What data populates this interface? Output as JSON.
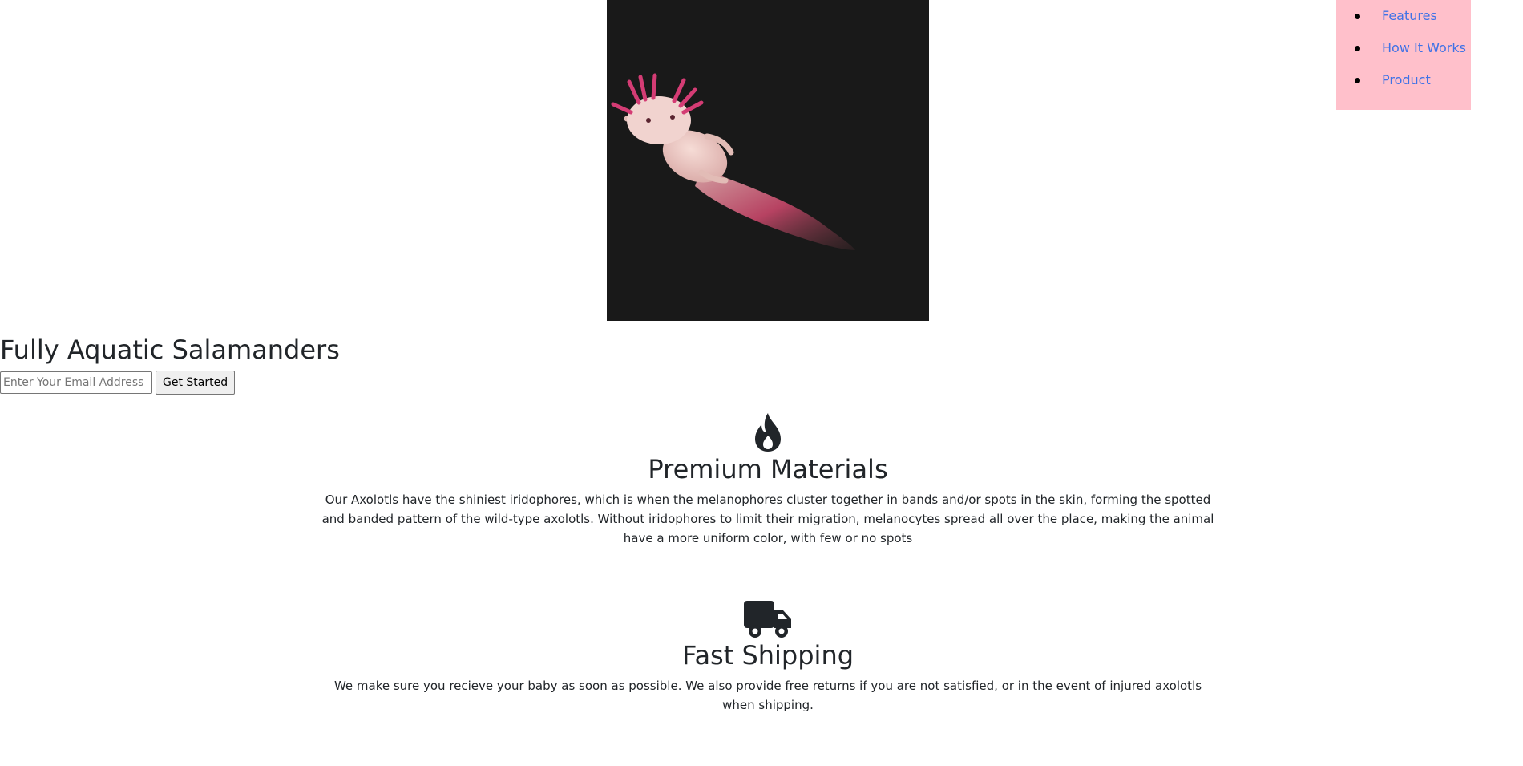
{
  "nav": {
    "items": [
      {
        "label": "Features"
      },
      {
        "label": "How It Works"
      },
      {
        "label": "Product"
      }
    ]
  },
  "hero": {
    "image_alt": "Pink axolotl",
    "title": "Fully Aquatic Salamanders",
    "email_placeholder": "Enter Your Email Address",
    "submit_label": "Get Started"
  },
  "features": [
    {
      "icon": "fire-icon",
      "title": "Premium Materials",
      "text": "Our Axolotls have the shiniest iridophores, which is when the melanophores cluster together in bands and/or spots in the skin, forming the spotted and banded pattern of the wild-type axolotls. Without iridophores to limit their migration, melanocytes spread all over the place, making the animal have a more uniform color, with few or no spots"
    },
    {
      "icon": "truck-icon",
      "title": "Fast Shipping",
      "text": "We make sure you recieve your baby as soon as possible. We also provide free returns if you are not satisfied, or in the event of injured axolotls when shipping."
    }
  ],
  "colors": {
    "nav_background": "#ffc0cb",
    "link": "#3f72e6",
    "text": "#212529",
    "image_background": "#191919"
  }
}
